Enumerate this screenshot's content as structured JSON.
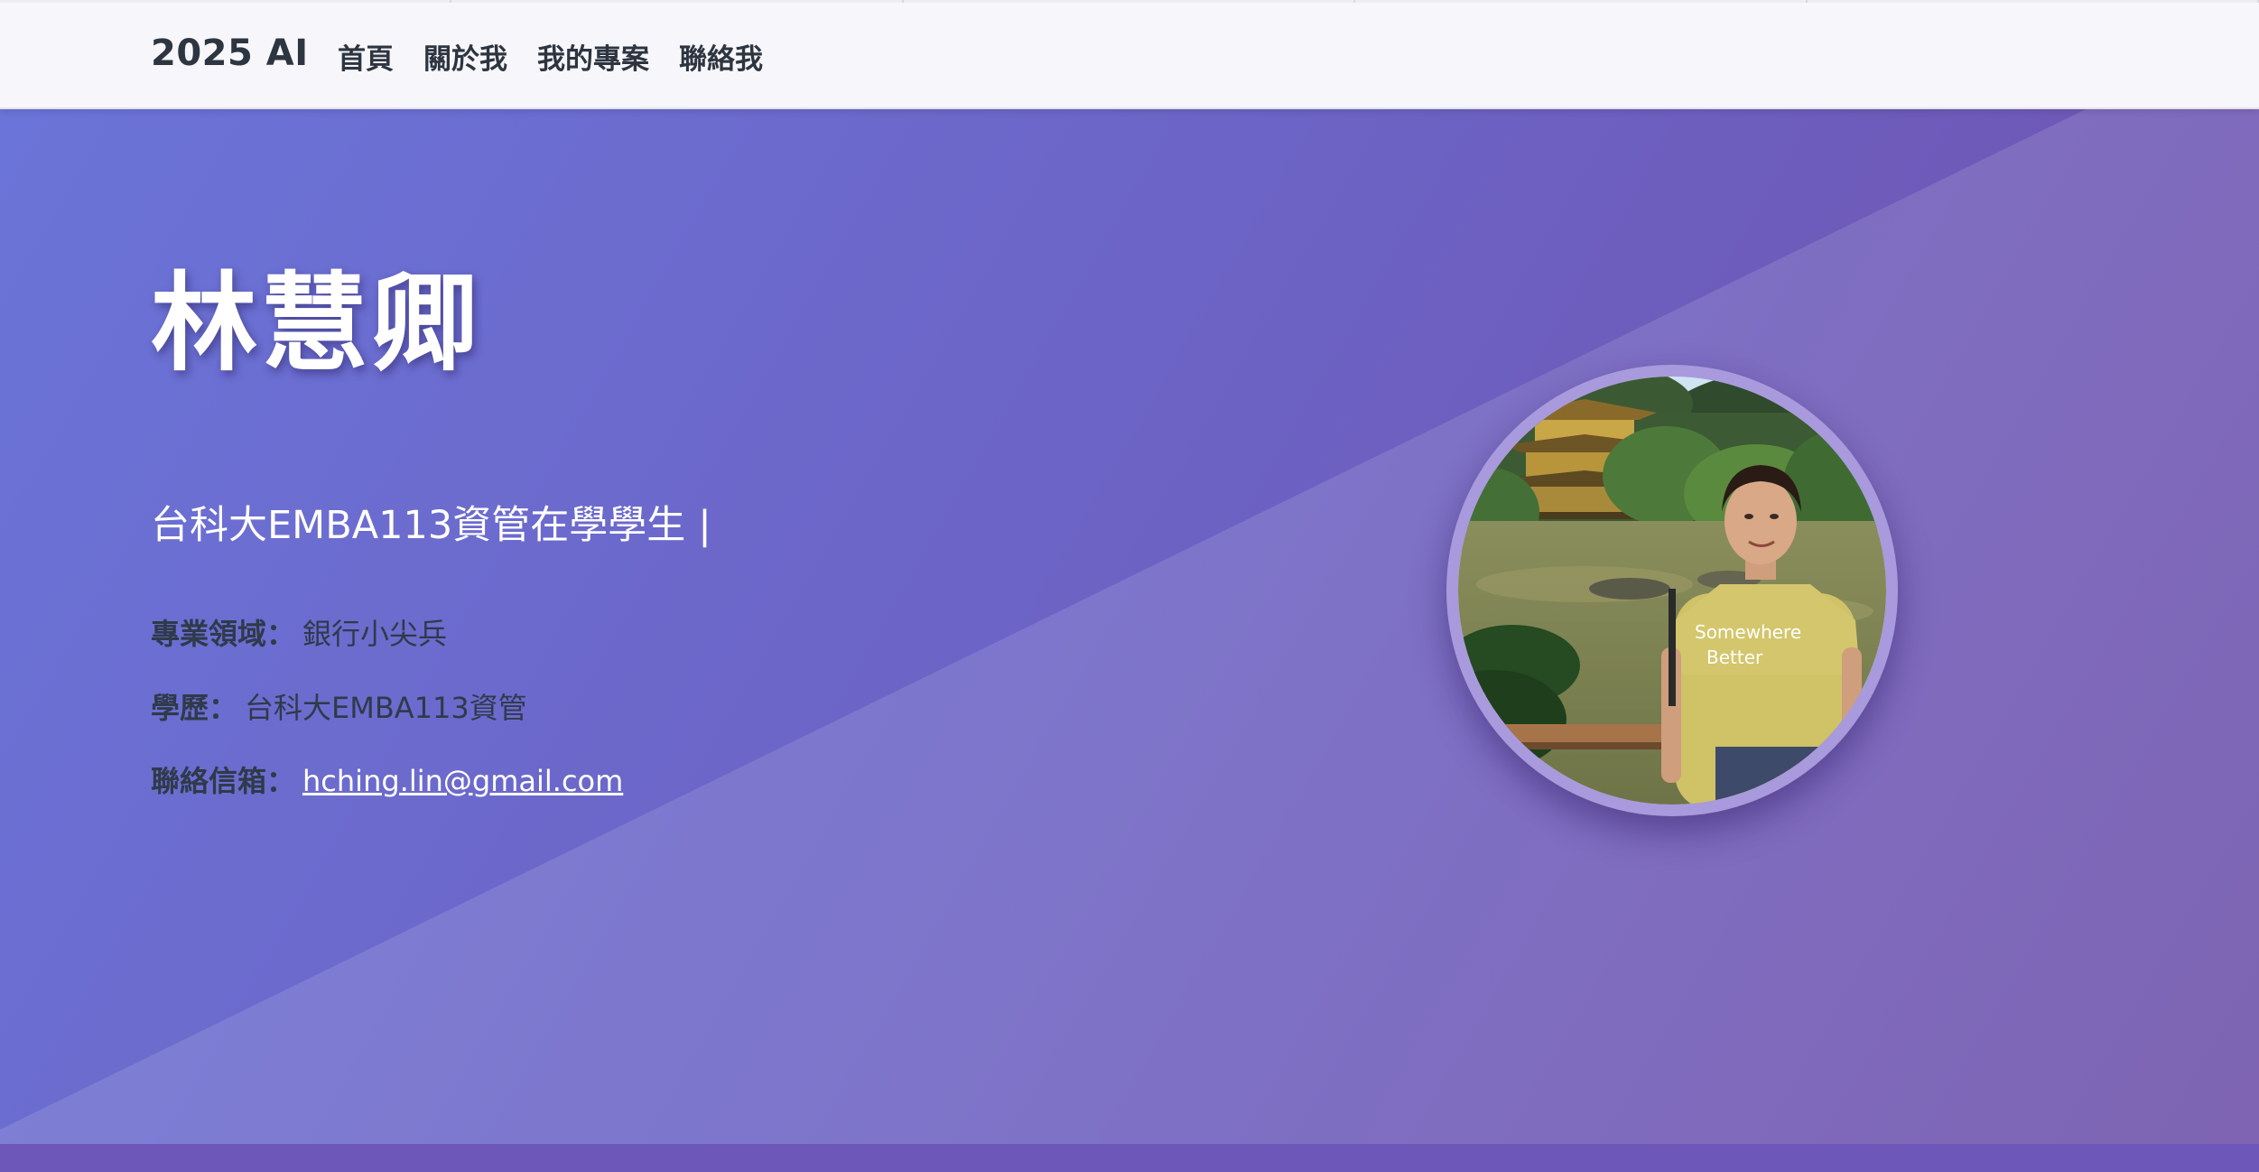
{
  "nav": {
    "brand": "2025 AI",
    "links": [
      "首頁",
      "關於我",
      "我的專案",
      "聯絡我"
    ]
  },
  "hero": {
    "name": "林慧卿",
    "subtitle": "台科大EMBA113資管在學學生",
    "cursor": "|",
    "field_label": "專業領域：",
    "field_value": "銀行小尖兵",
    "edu_label": "學歷：",
    "edu_value": "台科大EMBA113資管",
    "email_label": "聯絡信箱：",
    "email_value": "hching.lin@gmail.com"
  },
  "avatar": {
    "shirt_text_line1": "Somewhere",
    "shirt_text_line2": "Better"
  },
  "colors": {
    "hero_gradient_start": "#6b74d8",
    "hero_gradient_end": "#6d4fa8",
    "nav_background": "#f7f6fa",
    "nav_text": "#2d3540",
    "avatar_ring": "#a89adc"
  }
}
